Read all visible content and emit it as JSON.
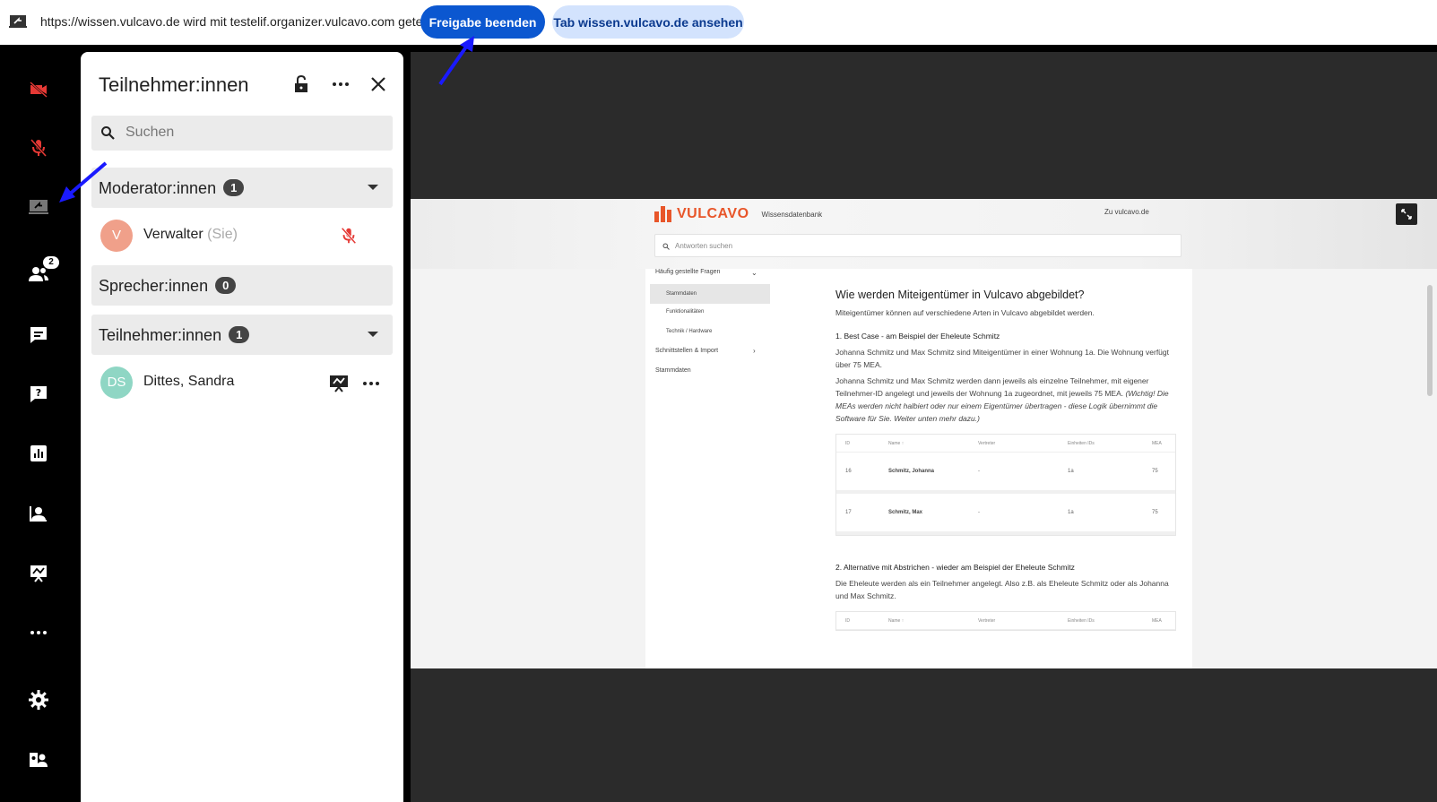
{
  "sharebar": {
    "text": "https://wissen.vulcavo.de wird mit testelif.organizer.vulcavo.com geteilt",
    "stop_label": "Freigabe beenden",
    "view_label": "Tab wissen.vulcavo.de ansehen"
  },
  "rail": {
    "participants_badge": "2",
    "icons": [
      "camera-off-icon",
      "mic-off-icon",
      "screen-share-icon",
      "participants-icon",
      "chat-icon",
      "qa-icon",
      "poll-icon",
      "user-board-icon",
      "presentation-icon",
      "more-icon",
      "settings-icon",
      "manage-users-icon"
    ]
  },
  "panel": {
    "title": "Teilnehmer:innen",
    "search_placeholder": "Suchen",
    "sections": [
      {
        "label": "Moderator:innen",
        "count": "1"
      },
      {
        "label": "Sprecher:innen",
        "count": "0"
      },
      {
        "label": "Teilnehmer:innen",
        "count": "1"
      }
    ],
    "moderator": {
      "initial": "V",
      "name": "Verwalter",
      "suffix": "(Sie)",
      "avatar_color": "#f0a08a"
    },
    "participant": {
      "initials": "DS",
      "name": "Dittes, Sandra",
      "avatar_color": "#8fd6c4"
    }
  },
  "shared": {
    "brand": "VULCAVO",
    "brand_sub": "Wissensdatenbank",
    "site_link": "Zu vulcavo.de",
    "search_placeholder": "Antworten suchen",
    "nav": {
      "faq": "Häufig gestellte Fragen",
      "stammdaten_sub": "Stammdaten",
      "funktionalitaeten": "Funktionalitäten",
      "technik": "Technik / Hardware",
      "schnittstellen": "Schnittstellen & Import",
      "stammdaten": "Stammdaten"
    },
    "article": {
      "title": "Wie werden Miteigentümer in Vulcavo abgebildet?",
      "intro": "Miteigentümer können auf verschiedene Arten in Vulcavo abgebildet werden.",
      "h1": "1. Best Case - am Beispiel der Eheleute Schmitz",
      "p1": "Johanna Schmitz und Max Schmitz sind Miteigentümer in einer Wohnung 1a. Die Wohnung verfügt über 75 MEA.",
      "p2": "Johanna Schmitz und Max Schmitz werden dann jeweils als einzelne Teilnehmer, mit eigener Teilnehmer-ID angelegt und jeweils der Wohnung 1a zugeordnet, mit jeweils 75 MEA.",
      "p2_note": "(Wichtig! Die MEAs werden nicht halbiert oder nur einem Eigentümer übertragen - diese Logik übernimmt die Software für Sie. Weiter unten mehr dazu.)",
      "table_headers": [
        "ID",
        "Name ↑",
        "Vertreter",
        "Einheiten IDs",
        "MEA"
      ],
      "rows": [
        [
          "16",
          "Schmitz, Johanna",
          "-",
          "1a",
          "75"
        ],
        [
          "17",
          "Schmitz, Max",
          "-",
          "1a",
          "75"
        ]
      ],
      "h2": "2. Alternative mit Abstrichen - wieder am Beispiel der Eheleute Schmitz",
      "p3": "Die Eheleute werden als ein Teilnehmer angelegt. Also z.B. als Eheleute Schmitz oder als Johanna und Max Schmitz."
    }
  },
  "colors": {
    "accent": "#0b57d0",
    "brand": "#e8562a",
    "muted_red": "#e53935"
  }
}
